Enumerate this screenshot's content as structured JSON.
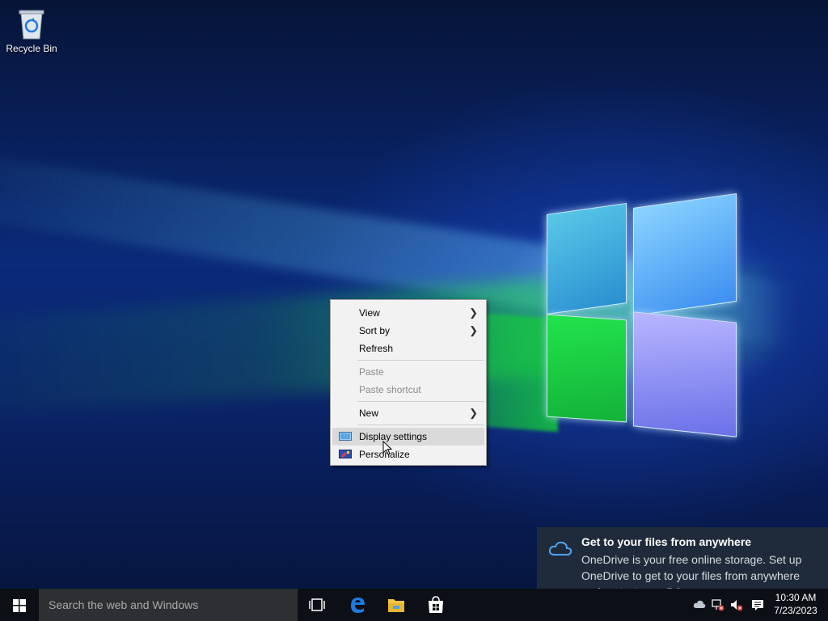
{
  "desktop": {
    "icons": [
      {
        "label": "Recycle Bin",
        "icon": "recycle-bin-icon"
      }
    ]
  },
  "context_menu": {
    "items": [
      {
        "label": "View",
        "has_submenu": true,
        "enabled": true
      },
      {
        "label": "Sort by",
        "has_submenu": true,
        "enabled": true
      },
      {
        "label": "Refresh",
        "enabled": true
      },
      {
        "label": "Paste",
        "enabled": false
      },
      {
        "label": "Paste shortcut",
        "enabled": false
      },
      {
        "label": "New",
        "has_submenu": true,
        "enabled": true
      },
      {
        "label": "Display settings",
        "icon": "display-settings-icon",
        "enabled": true,
        "highlighted": true
      },
      {
        "label": "Personalize",
        "icon": "personalize-icon",
        "enabled": true
      }
    ]
  },
  "notification": {
    "icon": "onedrive-cloud-icon",
    "title": "Get to your files from anywhere",
    "body": "OneDrive is your free online storage. Set up OneDrive to get to your files from anywhere and protect your PC."
  },
  "taskbar": {
    "search_placeholder": "Search the web and Windows",
    "pinned": [
      "task-view-icon",
      "edge-icon",
      "file-explorer-icon",
      "store-icon"
    ],
    "tray_icons": [
      "onedrive-tray-icon",
      "network-icon",
      "volume-icon",
      "action-center-icon"
    ],
    "time": "10:30 AM",
    "date": "7/23/2023"
  },
  "colors": {
    "taskbar": "#0c0f16",
    "search_box": "#2e2f33",
    "menu_bg": "#f2f2f2",
    "menu_highlight": "#dadada",
    "toast_bg": "#1f2b3a",
    "edge_blue": "#1f7ae0",
    "explorer_yellow": "#f5c542"
  }
}
